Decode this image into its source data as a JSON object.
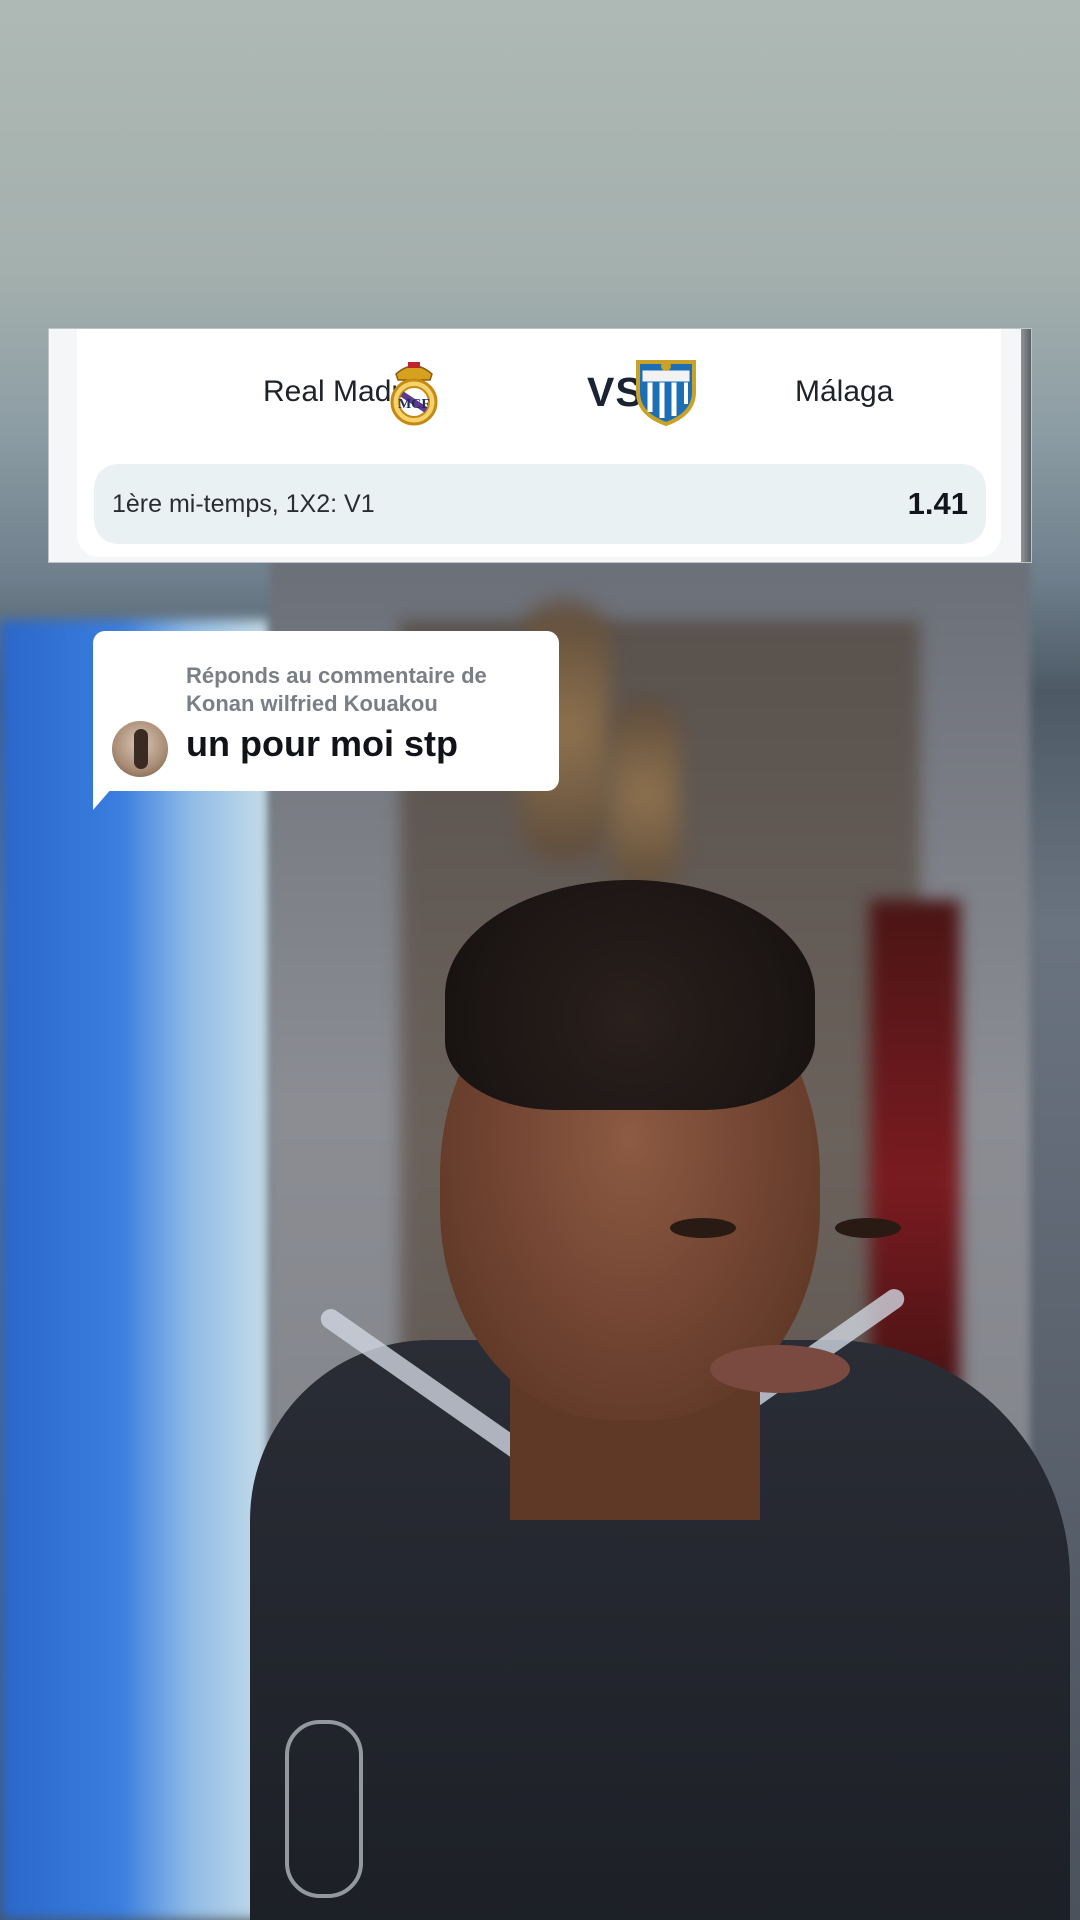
{
  "match": {
    "home_team": "Real Madrid",
    "vs_label": "VS",
    "away_team": "Málaga",
    "home_crest_icon": "real-madrid-crest-icon",
    "away_crest_icon": "malaga-crest-icon"
  },
  "bet": {
    "market": "1ère mi-temps, 1X2: V1",
    "odds": "1.41"
  },
  "reply": {
    "header": "Réponds au commentaire de Konan wilfried Kouakou",
    "comment": "un pour moi stp",
    "avatar_icon": "commenter-avatar"
  },
  "colors": {
    "card_bg": "#ffffff",
    "bet_row_bg": "#eaf1f3",
    "text_dark": "#1e2229"
  }
}
